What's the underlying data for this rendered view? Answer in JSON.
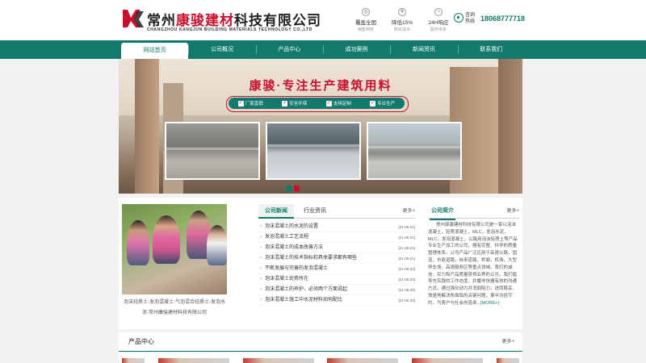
{
  "header": {
    "company_name_prefix": "常州",
    "company_name_highlight": "康骏建材",
    "company_name_suffix": "科技有限公司",
    "company_name_en": "CHANGZHOU KANGJUN BUILDING MATERIALS TECHNOLOGY CO.,LTD",
    "features": [
      {
        "title": "覆盖全国",
        "sub": "销售网络",
        "icon": "globe-icon"
      },
      {
        "title": "降低15%",
        "sub": "购买成本",
        "icon": "yen-icon"
      },
      {
        "title": "24H响应",
        "sub": "服务体系",
        "icon": "clock-icon"
      }
    ],
    "hotline_label": "咨询热线",
    "hotline_number": "18068777718"
  },
  "nav": {
    "items": [
      "网站首页",
      "公司概况",
      "产品中心",
      "成功案例",
      "新闻资讯",
      "联系我们"
    ],
    "active_index": 0
  },
  "banner": {
    "title": "康骏·专注生产建筑用料",
    "tags": [
      "厂家直销",
      "安全环保",
      "支持定制",
      "专业生产"
    ]
  },
  "news_photo": {
    "caption": "泡沫轻质土-发泡混凝土-气泡混合轻质土-发泡水泥-常州康骏建材科技有限公司"
  },
  "news": {
    "tabs": [
      "公司新闻",
      "行业资讯"
    ],
    "more": "更多+",
    "items": [
      {
        "title": "泡沫混凝土的水泥的设置",
        "date": "[21-06-21]"
      },
      {
        "title": "发泡混凝土工艺流程",
        "date": "[21-06-21]"
      },
      {
        "title": "泡沫混凝土的成本改善方法",
        "date": "[21-06-21]"
      },
      {
        "title": "泡沫混凝土的技术指标和具体要求都有哪些",
        "date": "[21-06-21]"
      },
      {
        "title": "不断发展与完善的发泡混凝土",
        "date": "[21-06-20]"
      },
      {
        "title": "泡沫混凝土优势所在",
        "date": "[21-06-20]"
      },
      {
        "title": "泡沫混凝土的养护，必须两个方面说起",
        "date": "[21-06-20]"
      },
      {
        "title": "泡沫混凝土施工中水泥材料如何配比",
        "date": "[21-06-20]"
      }
    ]
  },
  "about": {
    "title": "公司简介",
    "more": "更多+",
    "text": "常州康骏建材科技有限公司是一家以泡沫混凝土，轻质混凝土，MLC，发泡水泥，MLC，发泡混凝土，公路用泡沫轻质土等产品专业生产加工的公司，拥有完整、科学的质量管理体系。公司产品广泛应用于高速公路，国道，市政道路，自来道路，桥面，机场，大型停车场，高速服务区等重点领域。我们的诚信、实力和产品质量获得业界的认可。我们倡导先实践的工作态度，并履非快捷有效的沟通方式，通过强化动力并消弱阻力，进而稳妥、快速地解决所面临的关键问题，事半功倍节约，为客户与社会创造卓...",
    "readmore": "[MORE+]"
  },
  "products": {
    "title": "产品中心",
    "more": "更多+"
  },
  "colors": {
    "brand_green": "#127a6c",
    "brand_red": "#c8102e"
  }
}
